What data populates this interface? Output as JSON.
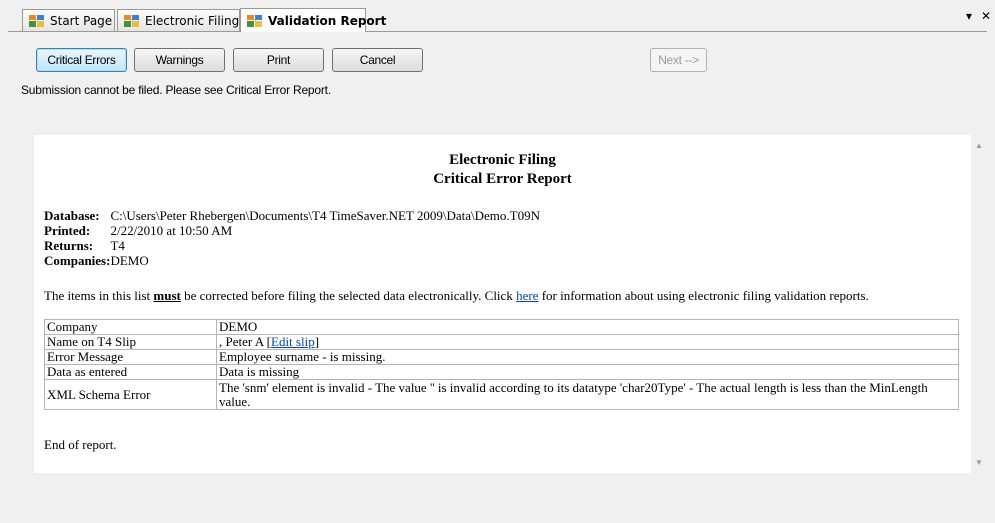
{
  "tabs": [
    {
      "label": "Start Page"
    },
    {
      "label": "Electronic Filing"
    },
    {
      "label": "Validation Report"
    }
  ],
  "tab_controls": {
    "dropdown": "▾",
    "close": "✕"
  },
  "toolbar": {
    "critical_errors": "Critical Errors",
    "warnings": "Warnings",
    "print": "Print",
    "cancel": "Cancel",
    "next": "Next -->"
  },
  "status_message": "Submission cannot be filed. Please see Critical Error Report.",
  "report": {
    "title": "Electronic Filing",
    "subtitle": "Critical Error Report",
    "meta": [
      {
        "key": "Database:",
        "value": "C:\\Users\\Peter Rhebergen\\Documents\\T4 TimeSaver.NET 2009\\Data\\Demo.T09N"
      },
      {
        "key": "Printed:",
        "value": "2/22/2010 at 10:50 AM"
      },
      {
        "key": "Returns:",
        "value": "T4"
      },
      {
        "key": "Companies:",
        "value": "DEMO"
      }
    ],
    "note_before": "The items in this list ",
    "note_must": "must",
    "note_middle": " be corrected before filing the selected data electronically. Click ",
    "note_link": "here",
    "note_after": " for information about using electronic filing validation reports.",
    "rows": [
      {
        "field": "Company",
        "value": "DEMO"
      },
      {
        "field": "Name on T4 Slip",
        "value_prefix": ", Peter A [",
        "link": "Edit slip",
        "value_suffix": "]"
      },
      {
        "field": "Error Message",
        "value": "Employee surname - is missing."
      },
      {
        "field": "Data as entered",
        "value": "Data is missing"
      },
      {
        "field": "XML Schema Error",
        "value": "The 'snm' element is invalid - The value '' is invalid according to its datatype 'char20Type' - The actual length is less than the MinLength value."
      }
    ],
    "end": "End of report."
  }
}
